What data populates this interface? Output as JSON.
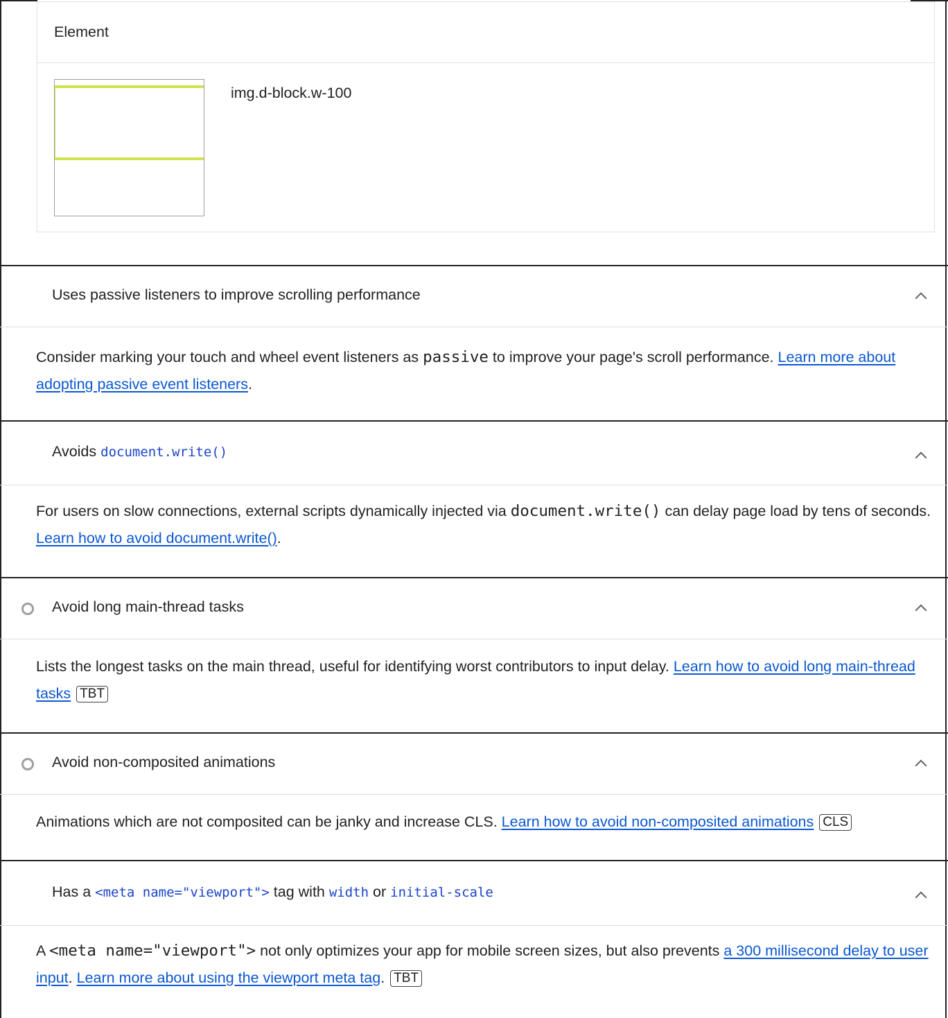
{
  "element_table": {
    "header": "Element",
    "row": {
      "selector": "img.d-block.w-100"
    }
  },
  "audits": [
    {
      "title": "Uses passive listeners to improve scrolling performance",
      "has_status_circle": false,
      "desc_before": "Consider marking your touch and wheel event listeners as ",
      "desc_code": "passive",
      "desc_after": " to improve your page's scroll performance. ",
      "link": "Learn more about adopting passive event listeners",
      "desc_end": "."
    },
    {
      "title_before": "Avoids ",
      "title_code": "document.write()",
      "has_status_circle": false,
      "desc_before": "For users on slow connections, external scripts dynamically injected via ",
      "desc_code": "document.write()",
      "desc_after": " can delay page load by tens of seconds. ",
      "link": "Learn how to avoid document.write()",
      "desc_end": "."
    },
    {
      "title": "Avoid long main-thread tasks",
      "has_status_circle": true,
      "desc_before": "Lists the longest tasks on the main thread, useful for identifying worst contributors to input delay. ",
      "link": "Learn how to avoid long main-thread tasks",
      "badge": "TBT"
    },
    {
      "title": "Avoid non-composited animations",
      "has_status_circle": true,
      "desc_before": "Animations which are not composited can be janky and increase CLS. ",
      "link": "Learn how to avoid non-composited animations",
      "badge": "CLS"
    },
    {
      "title_before": "Has a ",
      "title_code1": "<meta name=\"viewport\">",
      "title_mid1": " tag with ",
      "title_code2": "width",
      "title_mid2": " or ",
      "title_code3": "initial-scale",
      "has_status_circle": false,
      "desc_before": "A ",
      "desc_code": "<meta name=\"viewport\">",
      "desc_after": " not only optimizes your app for mobile screen sizes, but also prevents ",
      "link": "a 300 millisecond delay to user input",
      "desc_mid": ". ",
      "link2": "Learn more about using the viewport meta tag",
      "desc_end": ".",
      "badge": "TBT"
    }
  ]
}
